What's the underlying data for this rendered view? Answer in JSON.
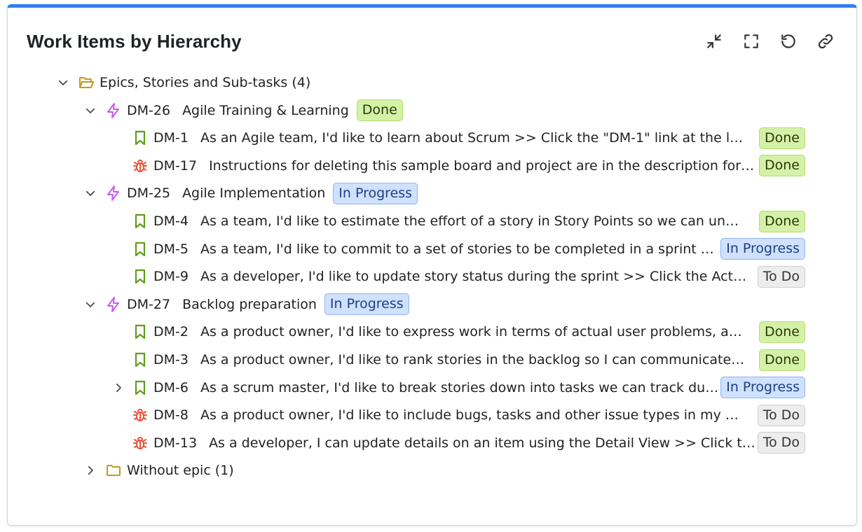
{
  "header": {
    "title": "Work Items by Hierarchy"
  },
  "actions": [
    "collapse-icon",
    "fullscreen-icon",
    "refresh-icon",
    "link-icon"
  ],
  "colors": {
    "accent": "#2f80ed",
    "epic": "#c45ee8",
    "story": "#5e9e1c",
    "bug": "#e5533d",
    "folder": "#c49a1c"
  },
  "root": {
    "label": "Epics, Stories and Sub-tasks (4)"
  },
  "epics": [
    {
      "key": "DM-26",
      "summary": "Agile Training & Learning",
      "status": "Done",
      "children": [
        {
          "type": "story",
          "key": "DM-1",
          "summary": "As an Agile team, I'd like to learn about Scrum >> Click the \"DM-1\" link at the lef…",
          "status": "Done"
        },
        {
          "type": "bug",
          "key": "DM-17",
          "summary": "Instructions for deleting this sample board and project are in the description for…",
          "status": "Done"
        }
      ]
    },
    {
      "key": "DM-25",
      "summary": "Agile Implementation",
      "status": "In Progress",
      "children": [
        {
          "type": "story",
          "key": "DM-4",
          "summary": "As a team, I'd like to estimate the effort of a story in Story Points so we can unde…",
          "status": "Done"
        },
        {
          "type": "story",
          "key": "DM-5",
          "summary": "As a team, I'd like to commit to a set of stories to be completed in a sprint …",
          "status": "In Progress"
        },
        {
          "type": "story",
          "key": "DM-9",
          "summary": "As a developer, I'd like to update story status during the sprint >> Click the Acti…",
          "status": "To Do"
        }
      ]
    },
    {
      "key": "DM-27",
      "summary": "Backlog preparation",
      "status": "In Progress",
      "children": [
        {
          "type": "story",
          "key": "DM-2",
          "summary": "As a product owner, I'd like to express work in terms of actual user problems, aka…",
          "status": "Done"
        },
        {
          "type": "story",
          "key": "DM-3",
          "summary": "As a product owner, I'd like to rank stories in the backlog so I can communicate t…",
          "status": "Done"
        },
        {
          "type": "story",
          "key": "DM-6",
          "summary": "As a scrum master, I'd like to break stories down into tasks we can track du…",
          "status": "In Progress",
          "expandable": true
        },
        {
          "type": "bug",
          "key": "DM-8",
          "summary": "As a product owner, I'd like to include bugs, tasks and other issue types in my ba…",
          "status": "To Do"
        },
        {
          "type": "bug",
          "key": "DM-13",
          "summary": "As a developer, I can update details on an item using the Detail View >> Click t…",
          "status": "To Do"
        }
      ]
    }
  ],
  "without_epic": {
    "label": "Without epic (1)"
  }
}
